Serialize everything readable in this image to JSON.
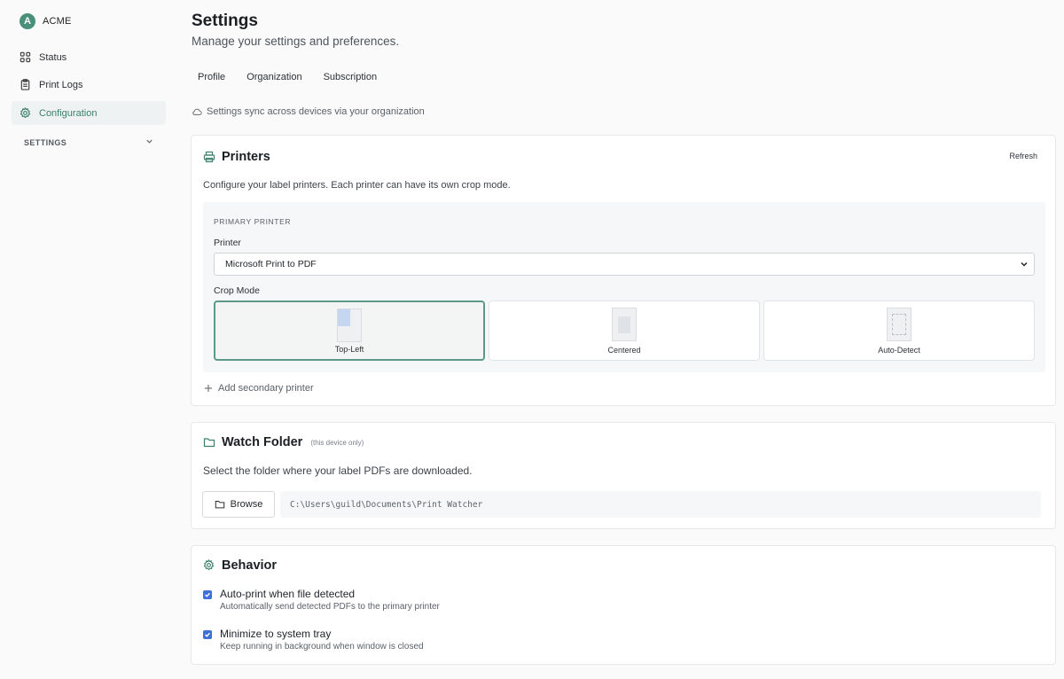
{
  "brand": {
    "initial": "A",
    "name": "ACME"
  },
  "sidebar": {
    "items": [
      {
        "label": "Status",
        "icon": "grid-icon"
      },
      {
        "label": "Print Logs",
        "icon": "clipboard-icon"
      },
      {
        "label": "Configuration",
        "icon": "gear-icon",
        "active": true
      }
    ],
    "section_label": "SETTINGS"
  },
  "header": {
    "title": "Settings",
    "subtitle": "Manage your settings and preferences."
  },
  "tabs": [
    {
      "label": "Profile"
    },
    {
      "label": "Organization"
    },
    {
      "label": "Subscription"
    }
  ],
  "sync_note": "Settings sync across devices via your organization",
  "printers": {
    "title": "Printers",
    "refresh_label": "Refresh",
    "description": "Configure your label printers. Each printer can have its own crop mode.",
    "primary_label": "PRIMARY PRINTER",
    "printer_field_label": "Printer",
    "selected_printer": "Microsoft Print to PDF",
    "crop_mode_label": "Crop Mode",
    "crop_modes": [
      {
        "label": "Top-Left",
        "selected": true
      },
      {
        "label": "Centered",
        "selected": false
      },
      {
        "label": "Auto-Detect",
        "selected": false
      }
    ],
    "add_secondary": "Add secondary printer"
  },
  "watch_folder": {
    "title": "Watch Folder",
    "note": "(this device only)",
    "description": "Select the folder where your label PDFs are downloaded.",
    "browse_label": "Browse",
    "path": "C:\\Users\\guild\\Documents\\Print Watcher"
  },
  "behavior": {
    "title": "Behavior",
    "options": [
      {
        "title": "Auto-print when file detected",
        "subtitle": "Automatically send detected PDFs to the primary printer",
        "checked": true
      },
      {
        "title": "Minimize to system tray",
        "subtitle": "Keep running in background when window is closed",
        "checked": true
      }
    ]
  },
  "colors": {
    "accent": "#3c7f6b",
    "selected_border": "#5b9a86",
    "checkbox": "#3f6fd8"
  }
}
